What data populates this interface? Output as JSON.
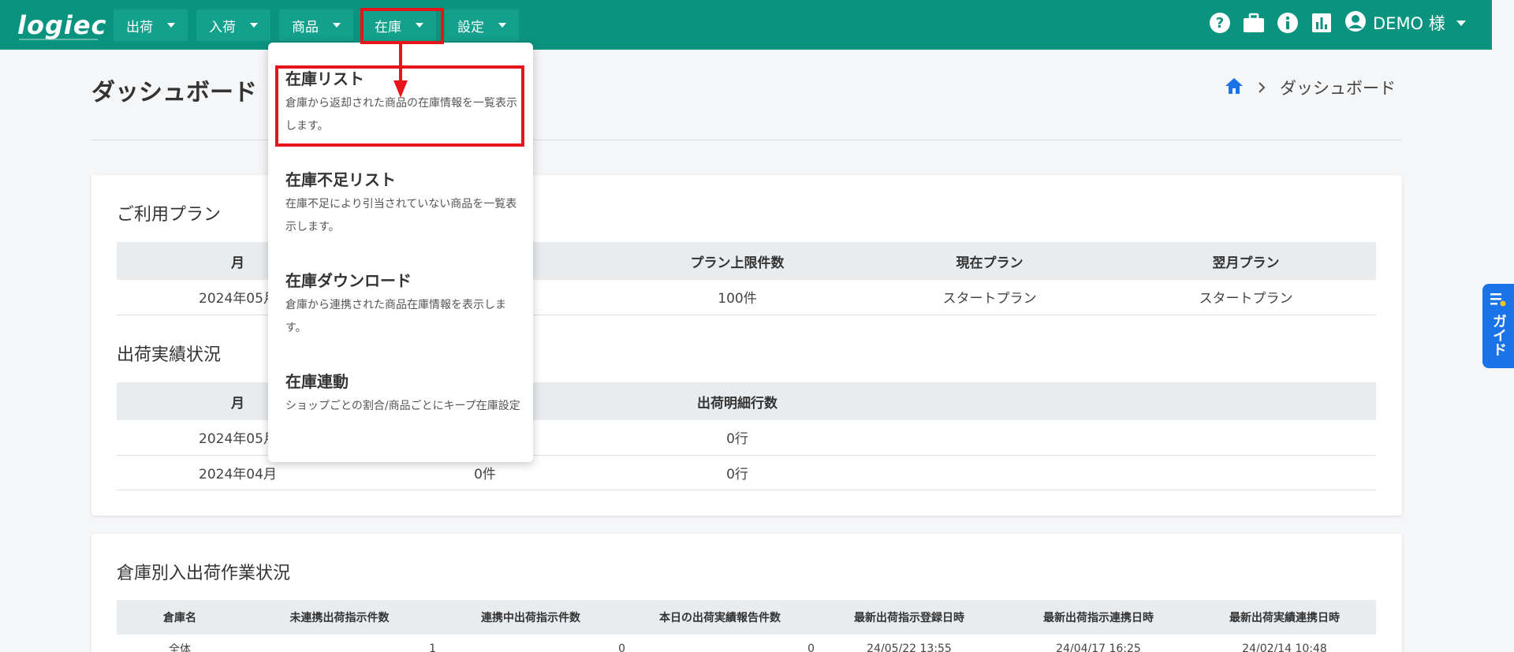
{
  "header": {
    "logo_text": "logiec",
    "nav": [
      {
        "label": "出荷"
      },
      {
        "label": "入荷"
      },
      {
        "label": "商品"
      },
      {
        "label": "在庫"
      },
      {
        "label": "設定"
      }
    ],
    "icons": [
      "help-icon",
      "briefcase-icon",
      "info-icon",
      "chart-icon"
    ],
    "user_label": "DEMO 様"
  },
  "page": {
    "title": "ダッシュボード",
    "breadcrumb_current": "ダッシュボード"
  },
  "dropdown": {
    "items": [
      {
        "title": "在庫リスト",
        "desc": "倉庫から返却された商品の在庫情報を一覧表示します。"
      },
      {
        "title": "在庫不足リスト",
        "desc": "在庫不足により引当されていない商品を一覧表示します。"
      },
      {
        "title": "在庫ダウンロード",
        "desc": "倉庫から連携された商品在庫情報を表示します。"
      },
      {
        "title": "在庫連動",
        "desc": "ショップごとの割合/商品ごとにキープ在庫設定"
      }
    ]
  },
  "plan": {
    "title": "ご利用プラン",
    "headers": [
      "月",
      "",
      "プラン上限件数",
      "現在プラン",
      "翌月プラン"
    ],
    "rows": [
      [
        "2024年05月",
        "",
        "100件",
        "スタートプラン",
        "スタートプラン"
      ]
    ]
  },
  "shipping": {
    "title": "出荷実績状況",
    "headers": [
      "月",
      "",
      "出荷明細行数",
      ""
    ],
    "rows": [
      [
        "2024年05月",
        "",
        "0行",
        ""
      ],
      [
        "2024年04月",
        "0件",
        "0行",
        ""
      ]
    ]
  },
  "warehouse": {
    "title": "倉庫別入出荷作業状況",
    "headers": [
      "倉庫名",
      "未連携出荷指示件数",
      "連携中出荷指示件数",
      "本日の出荷実績報告件数",
      "最新出荷指示登録日時",
      "最新出荷指示連携日時",
      "最新出荷実績連携日時"
    ],
    "rows": [
      [
        "全体",
        "1",
        "0",
        "0",
        "24/05/22 13:55",
        "24/04/17 16:25",
        "24/02/14 10:48"
      ]
    ]
  },
  "guide": {
    "label": "ガイド"
  },
  "colors": {
    "header": "#0a9480",
    "nav_button": "#13a08c",
    "highlight": "#e8141b",
    "guide": "#1a73e8",
    "home_icon": "#1a73e8"
  }
}
